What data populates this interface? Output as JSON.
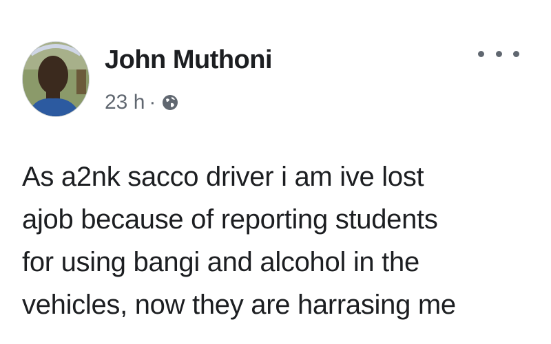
{
  "post": {
    "author": "John Muthoni",
    "time": "23 h",
    "separator": "·",
    "privacy_icon": "globe-icon",
    "more_icon": "more-options-icon",
    "text": "As a2nk sacco driver  i am  ive lost\najob because of reporting students\nfor using bangi and alcohol in the\nvehicles, now they are harrasing me"
  },
  "colors": {
    "text": "#1c1e21",
    "secondary": "#606770",
    "background": "#ffffff"
  }
}
